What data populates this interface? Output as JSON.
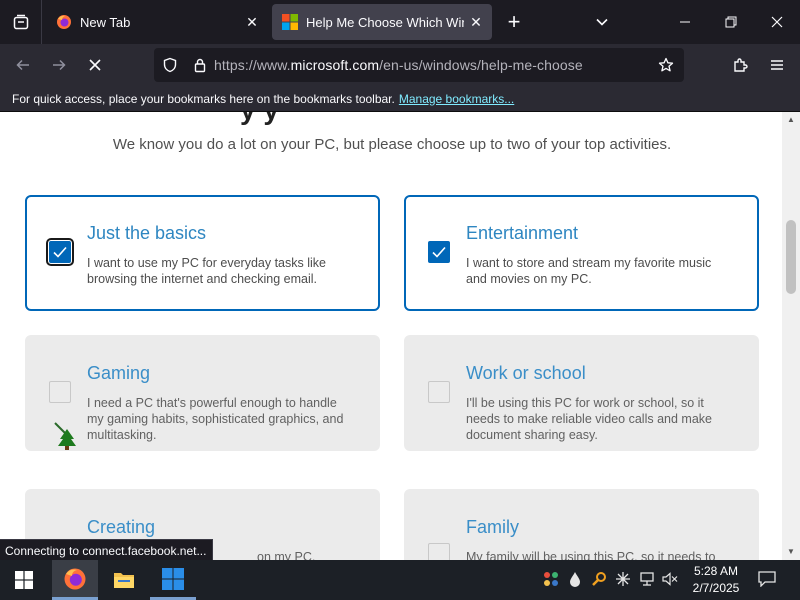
{
  "browser": {
    "tabs": [
      {
        "title": "New Tab",
        "active": false
      },
      {
        "title": "Help Me Choose Which Window",
        "active": true
      }
    ],
    "close_glyph": "✕",
    "new_tab_glyph": "+",
    "url": {
      "prefix": "https://www.",
      "host": "microsoft.com",
      "path": "/en-us/windows/help-me-choose"
    },
    "bookmarks_bar": {
      "message": "For quick access, place your bookmarks here on the bookmarks toolbar.",
      "link": "Manage bookmarks..."
    },
    "status": "Connecting to connect.facebook.net..."
  },
  "page": {
    "heading_fragment": "y         y",
    "intro": "We know you do a lot on your PC, but please choose up to two of your top activities.",
    "activities": [
      {
        "title": "Just the basics",
        "description": "I want to use my PC for everyday tasks like browsing the internet and checking email.",
        "checked": true
      },
      {
        "title": "Entertainment",
        "description": "I want to store and stream my favorite music and movies on my PC.",
        "checked": true
      },
      {
        "title": "Gaming",
        "description": "I need a PC that's powerful enough to handle my gaming habits, sophisticated graphics, and multitasking.",
        "checked": false
      },
      {
        "title": "Work or school",
        "description": "I'll be using this PC for work or school, so it needs to make reliable video calls and make document sharing easy.",
        "checked": false
      },
      {
        "title": "Creating",
        "description": "",
        "checked": false
      },
      {
        "title": "Family",
        "description": "My family will be using this PC, so it needs to",
        "checked": false
      }
    ],
    "partial_text_creating": "on my PC,"
  },
  "taskbar": {
    "clock_time": "5:28 AM",
    "clock_date": "2/7/2025"
  },
  "colors": {
    "accent": "#0067b8",
    "card_title": "#2e86c1",
    "chrome_dark": "#1c1b22",
    "chrome_mid": "#2b2a33",
    "taskbar": "#1c2026"
  }
}
